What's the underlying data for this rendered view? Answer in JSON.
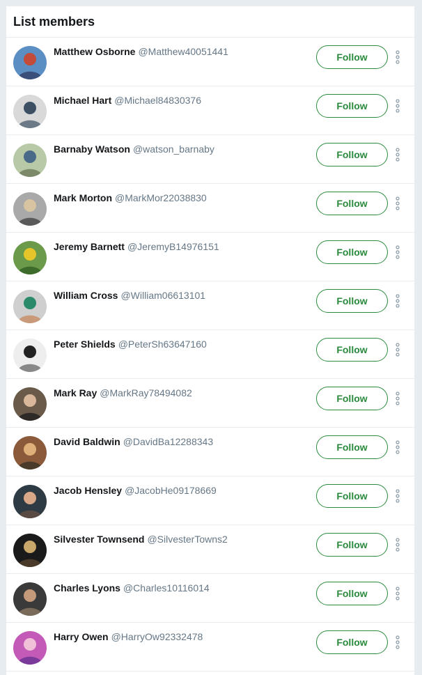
{
  "panel": {
    "title": "List members"
  },
  "colors": {
    "page_background": "#e6ecf0",
    "follow_accent": "#2a8a3b",
    "name_text": "#14171a",
    "handle_text": "#657786"
  },
  "members": [
    {
      "name": "Matthew Osborne",
      "handle": "@Matthew40051441",
      "follow_label": "Follow",
      "avatar_colors": [
        "#5b8fc4",
        "#c24b3a",
        "#3a4f7a"
      ]
    },
    {
      "name": "Michael Hart",
      "handle": "@Michael84830376",
      "follow_label": "Follow",
      "avatar_colors": [
        "#d9d9d9",
        "#3c4f63",
        "#6b7a86"
      ]
    },
    {
      "name": "Barnaby Watson",
      "handle": "@watson_barnaby",
      "follow_label": "Follow",
      "avatar_colors": [
        "#b8c9a8",
        "#4a6a8a",
        "#7c8a6a"
      ]
    },
    {
      "name": "Mark Morton",
      "handle": "@MarkMor22038830",
      "follow_label": "Follow",
      "avatar_colors": [
        "#a9a9a9",
        "#d8c4a0",
        "#5a5a5a"
      ]
    },
    {
      "name": "Jeremy Barnett",
      "handle": "@JeremyB14976151",
      "follow_label": "Follow",
      "avatar_colors": [
        "#6a9a4a",
        "#e6c52a",
        "#3d6b2b"
      ]
    },
    {
      "name": "William Cross",
      "handle": "@William06613101",
      "follow_label": "Follow",
      "avatar_colors": [
        "#cfcfcf",
        "#2a8a6a",
        "#c99a7a"
      ]
    },
    {
      "name": "Peter Shields",
      "handle": "@PeterSh63647160",
      "follow_label": "Follow",
      "avatar_colors": [
        "#eeeeee",
        "#222222",
        "#888888"
      ]
    },
    {
      "name": "Mark Ray",
      "handle": "@MarkRay78494082",
      "follow_label": "Follow",
      "avatar_colors": [
        "#6a5a4a",
        "#d9b79a",
        "#2d2a28"
      ]
    },
    {
      "name": "David Baldwin",
      "handle": "@DavidBa12288343",
      "follow_label": "Follow",
      "avatar_colors": [
        "#8a5a3a",
        "#e0b07a",
        "#4a3a2a"
      ]
    },
    {
      "name": "Jacob Hensley",
      "handle": "@JacobHe09178669",
      "follow_label": "Follow",
      "avatar_colors": [
        "#2e3a44",
        "#d8a888",
        "#5a4a44"
      ]
    },
    {
      "name": "Silvester Townsend",
      "handle": "@SilvesterTowns2",
      "follow_label": "Follow",
      "avatar_colors": [
        "#1a1a1a",
        "#c9a66a",
        "#4a3a2a"
      ]
    },
    {
      "name": "Charles Lyons",
      "handle": "@Charles10116014",
      "follow_label": "Follow",
      "avatar_colors": [
        "#3a3a3a",
        "#c49a7a",
        "#7a6a5a"
      ]
    },
    {
      "name": "Harry Owen",
      "handle": "@HarryOw92332478",
      "follow_label": "Follow",
      "avatar_colors": [
        "#c45ab8",
        "#f0c0d8",
        "#7a3a9a"
      ]
    }
  ],
  "icons": {
    "more": "vertical-ellipsis-icon"
  }
}
